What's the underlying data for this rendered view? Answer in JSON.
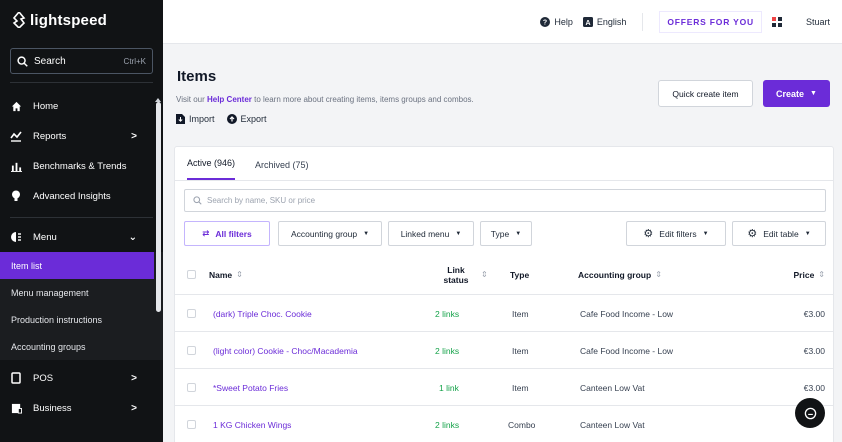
{
  "sidebar": {
    "brand": "lightspeed",
    "search": {
      "label": "Search",
      "shortcut": "Ctrl+K"
    },
    "items": [
      {
        "label": "Home",
        "icon": "home-icon",
        "has_chevron": false
      },
      {
        "label": "Reports",
        "icon": "chart-line-icon",
        "has_chevron": true
      },
      {
        "label": "Benchmarks & Trends",
        "icon": "bar-chart-icon",
        "has_chevron": false
      },
      {
        "label": "Advanced Insights",
        "icon": "lightbulb-icon",
        "has_chevron": false
      }
    ],
    "menu": {
      "label": "Menu",
      "icon": "menu-icon",
      "expanded": true
    },
    "submenu": [
      {
        "label": "Item list",
        "active": true
      },
      {
        "label": "Menu management",
        "active": false
      },
      {
        "label": "Production instructions",
        "active": false
      },
      {
        "label": "Accounting groups",
        "active": false
      }
    ],
    "bottom_items": [
      {
        "label": "POS",
        "icon": "tablet-icon"
      },
      {
        "label": "Business",
        "icon": "business-icon"
      }
    ]
  },
  "topbar": {
    "help": "Help",
    "language": "English",
    "offers": "OFFERS FOR YOU",
    "user": "Stuart"
  },
  "page": {
    "title": "Items",
    "help_prefix": "Visit our ",
    "help_link": "Help Center",
    "help_suffix": " to learn more about creating items, items groups and combos.",
    "import_label": "Import",
    "export_label": "Export",
    "quick_create_label": "Quick create item",
    "create_label": "Create"
  },
  "tabs": [
    {
      "label": "Active (946)",
      "active": true
    },
    {
      "label": "Archived (75)",
      "active": false
    }
  ],
  "search": {
    "placeholder": "Search by name, SKU or price"
  },
  "filters": {
    "all": "All filters",
    "accounting_group": "Accounting group",
    "linked_menu": "Linked menu",
    "type": "Type",
    "edit_filters": "Edit filters",
    "edit_table": "Edit table"
  },
  "table": {
    "columns": {
      "name": "Name",
      "link_status_1": "Link",
      "link_status_2": "status",
      "type": "Type",
      "accounting_group": "Accounting group",
      "price": "Price"
    },
    "rows": [
      {
        "name": "(dark) Triple Choc. Cookie",
        "links": "2 links",
        "type": "Item",
        "group": "Cafe Food Income - Low",
        "price": "€3.00"
      },
      {
        "name": "(light color) Cookie - Choc/Macademia",
        "links": "2 links",
        "type": "Item",
        "group": "Cafe Food Income - Low",
        "price": "€3.00"
      },
      {
        "name": "*Sweet Potato Fries",
        "links": "1 link",
        "type": "Item",
        "group": "Canteen Low Vat",
        "price": "€3.00"
      },
      {
        "name": "1 KG Chicken Wings",
        "links": "2 links",
        "type": "Combo",
        "group": "Canteen Low Vat",
        "price": ""
      }
    ]
  },
  "colors": {
    "accent": "#6b2cd8",
    "sidebar_bg": "#111315",
    "link_green": "#16a34a"
  }
}
